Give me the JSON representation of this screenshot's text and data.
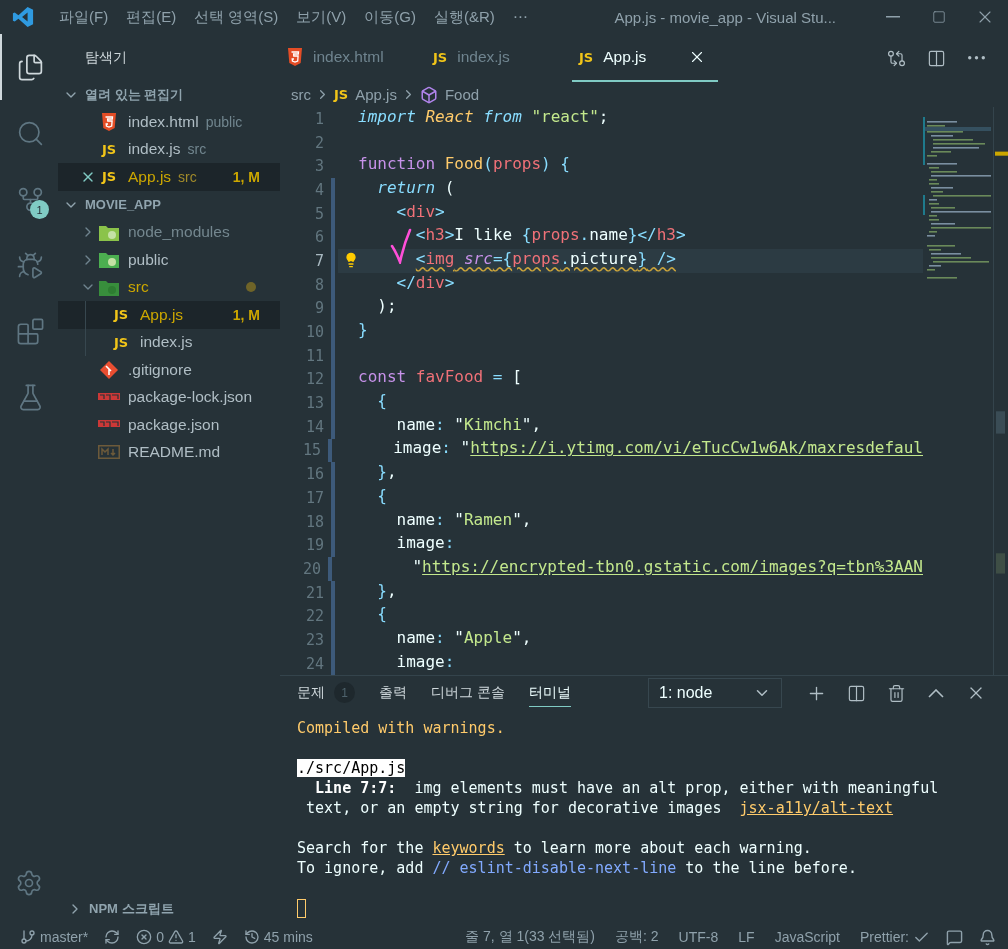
{
  "title_bar": {
    "menus": [
      "파일(F)",
      "편집(E)",
      "선택 영역(S)",
      "보기(V)",
      "이동(G)",
      "실행(&R)"
    ],
    "more": "⋯",
    "title": "App.js - movie_app - Visual Stu..."
  },
  "activity_bar": {
    "items": [
      {
        "kind": "explorer",
        "selected": true
      },
      {
        "kind": "search",
        "selected": false
      },
      {
        "kind": "source-control",
        "selected": false,
        "badge": "1"
      },
      {
        "kind": "run-debug",
        "selected": false
      },
      {
        "kind": "extensions",
        "selected": false
      },
      {
        "kind": "testing",
        "selected": false
      }
    ]
  },
  "explorer": {
    "title": "탐색기",
    "open_editors": {
      "title": "열려 있는 편집기",
      "expanded": true,
      "items": [
        {
          "kind": "html",
          "name": "index.html",
          "folder": "public",
          "selected": false,
          "warning": false
        },
        {
          "kind": "js",
          "icon_label": "JS",
          "name": "index.js",
          "folder": "src",
          "selected": false,
          "warning": false
        },
        {
          "kind": "js",
          "icon_label": "JS",
          "name": "App.js",
          "folder": "src",
          "badge": "1, M",
          "selected": true,
          "warning": true
        }
      ]
    },
    "project": {
      "title": "MOVIE_APP",
      "expanded": true,
      "items": [
        {
          "kind": "folder-node",
          "name": "node_modules",
          "expanded": false,
          "ignored": true,
          "selected": false,
          "warning": false,
          "modified": false
        },
        {
          "kind": "folder-public",
          "name": "public",
          "expanded": false,
          "ignored": false,
          "selected": false,
          "warning": false,
          "modified": false
        },
        {
          "kind": "folder-src",
          "name": "src",
          "expanded": true,
          "ignored": false,
          "selected": false,
          "warning": true,
          "modified": true,
          "children": [
            {
              "kind": "js",
              "icon_label": "JS",
              "name": "App.js",
              "badge": "1, M",
              "ignored": false,
              "selected": true,
              "warning": true
            },
            {
              "kind": "js",
              "icon_label": "JS",
              "name": "index.js",
              "ignored": false,
              "selected": false,
              "warning": false
            }
          ]
        },
        {
          "kind": "git",
          "name": ".gitignore",
          "ignored": false,
          "selected": false,
          "warning": false
        },
        {
          "kind": "npm",
          "name": "package-lock.json",
          "ignored": false,
          "selected": false,
          "warning": false
        },
        {
          "kind": "npm",
          "name": "package.json",
          "ignored": false,
          "selected": false,
          "warning": false
        },
        {
          "kind": "markdown",
          "name": "README.md",
          "ignored": false,
          "selected": false,
          "warning": false
        }
      ]
    },
    "npm_scripts": {
      "title": "NPM 스크립트",
      "expanded": false
    }
  },
  "editor": {
    "tabs": [
      {
        "kind": "html",
        "label": "index.html",
        "selected": false
      },
      {
        "kind": "js",
        "icon_label": "JS",
        "label": "index.js",
        "selected": false
      },
      {
        "kind": "js",
        "icon_label": "JS",
        "label": "App.js",
        "selected": true
      }
    ],
    "breadcrumb": [
      {
        "text": "src"
      },
      {
        "kind": "js",
        "icon_label": "JS",
        "text": "App.js"
      },
      {
        "kind": "symbol",
        "text": "Food"
      }
    ],
    "code": [
      {
        "number": "1",
        "modified": false,
        "current": false,
        "warning": false,
        "tokens": [
          {
            "text": "import",
            "kind": "kw"
          },
          {
            "text": " React",
            "kind": "cls"
          },
          {
            "text": " from",
            "kind": "kw"
          },
          {
            "text": " \"react\"",
            "kind": "str"
          },
          {
            "text": ";",
            "kind": "plain"
          }
        ]
      },
      {
        "number": "2",
        "modified": false,
        "current": false
      },
      {
        "number": "3",
        "modified": false,
        "current": false,
        "warning": false,
        "tokens": [
          {
            "text": "function",
            "kind": "decl"
          },
          {
            "text": " Food",
            "kind": "fn"
          },
          {
            "text": "(",
            "kind": "punct"
          },
          {
            "text": "props",
            "kind": "var"
          },
          {
            "text": ")",
            "kind": "punct"
          },
          {
            "text": " {",
            "kind": "punct"
          }
        ]
      },
      {
        "number": "4",
        "modified": true,
        "current": false,
        "warning": false,
        "tokens": [
          {
            "text": "  return",
            "kind": "kw"
          },
          {
            "text": " (",
            "kind": "plain"
          }
        ]
      },
      {
        "number": "5",
        "modified": true,
        "current": false,
        "warning": false,
        "tokens": [
          {
            "text": "    <",
            "kind": "punct"
          },
          {
            "text": "div",
            "kind": "var"
          },
          {
            "text": ">",
            "kind": "punct"
          }
        ]
      },
      {
        "number": "6",
        "modified": true,
        "current": false,
        "warning": false,
        "tokens": [
          {
            "text": "      <",
            "kind": "punct"
          },
          {
            "text": "h3",
            "kind": "var"
          },
          {
            "text": ">",
            "kind": "punct"
          },
          {
            "text": "I like ",
            "kind": "plain"
          },
          {
            "text": "{",
            "kind": "punct"
          },
          {
            "text": "props",
            "kind": "var"
          },
          {
            "text": ".",
            "kind": "punct"
          },
          {
            "text": "name",
            "kind": "plain"
          },
          {
            "text": "}</",
            "kind": "punct"
          },
          {
            "text": "h3",
            "kind": "var"
          },
          {
            "text": ">",
            "kind": "punct"
          }
        ]
      },
      {
        "number": "7",
        "modified": true,
        "current": true,
        "warning": true,
        "tokens": [
          {
            "text": "      <",
            "kind": "punct"
          },
          {
            "text": "img",
            "kind": "var"
          },
          {
            "text": " src",
            "kind": "attr"
          },
          {
            "text": "={",
            "kind": "punct"
          },
          {
            "text": "props",
            "kind": "var"
          },
          {
            "text": ".",
            "kind": "punct"
          },
          {
            "text": "picture",
            "kind": "plain"
          },
          {
            "text": "}",
            "kind": "punct"
          },
          {
            "text": " />",
            "kind": "punct"
          }
        ]
      },
      {
        "number": "8",
        "modified": true,
        "current": false,
        "warning": false,
        "tokens": [
          {
            "text": "    </",
            "kind": "punct"
          },
          {
            "text": "div",
            "kind": "var"
          },
          {
            "text": ">",
            "kind": "punct"
          }
        ]
      },
      {
        "number": "9",
        "modified": true,
        "current": false,
        "warning": false,
        "tokens": [
          {
            "text": "  );",
            "kind": "plain"
          }
        ]
      },
      {
        "number": "10",
        "modified": true,
        "current": false,
        "warning": false,
        "tokens": [
          {
            "text": "}",
            "kind": "punct"
          }
        ]
      },
      {
        "number": "11",
        "modified": true,
        "current": false
      },
      {
        "number": "12",
        "modified": true,
        "current": false,
        "warning": false,
        "tokens": [
          {
            "text": "const",
            "kind": "decl"
          },
          {
            "text": " favFood",
            "kind": "var"
          },
          {
            "text": " =",
            "kind": "punct"
          },
          {
            "text": " [",
            "kind": "plain"
          }
        ]
      },
      {
        "number": "13",
        "modified": true,
        "current": false,
        "warning": false,
        "tokens": [
          {
            "text": "  {",
            "kind": "punct"
          }
        ]
      },
      {
        "number": "14",
        "modified": true,
        "current": false,
        "warning": false,
        "tokens": [
          {
            "text": "    name",
            "kind": "plain"
          },
          {
            "text": ":",
            "kind": "punct"
          },
          {
            "text": " \"",
            "kind": "plain"
          },
          {
            "text": "Kimchi",
            "kind": "str"
          },
          {
            "text": "\",",
            "kind": "plain"
          }
        ]
      },
      {
        "number": "15",
        "modified": true,
        "current": false,
        "warning": false,
        "tokens": [
          {
            "text": "    image",
            "kind": "plain"
          },
          {
            "text": ":",
            "kind": "punct"
          },
          {
            "text": " \"",
            "kind": "plain"
          },
          {
            "text": "https://i.ytimg.com/vi/eTucCw1w6Ak/maxresdefaul",
            "kind": "url"
          }
        ]
      },
      {
        "number": "16",
        "modified": true,
        "current": false,
        "warning": false,
        "tokens": [
          {
            "text": "  }",
            "kind": "punct"
          },
          {
            "text": ",",
            "kind": "plain"
          }
        ]
      },
      {
        "number": "17",
        "modified": true,
        "current": false,
        "warning": false,
        "tokens": [
          {
            "text": "  {",
            "kind": "punct"
          }
        ]
      },
      {
        "number": "18",
        "modified": true,
        "current": false,
        "warning": false,
        "tokens": [
          {
            "text": "    name",
            "kind": "plain"
          },
          {
            "text": ":",
            "kind": "punct"
          },
          {
            "text": " \"",
            "kind": "plain"
          },
          {
            "text": "Ramen",
            "kind": "str"
          },
          {
            "text": "\",",
            "kind": "plain"
          }
        ]
      },
      {
        "number": "19",
        "modified": true,
        "current": false,
        "warning": false,
        "tokens": [
          {
            "text": "    image",
            "kind": "plain"
          },
          {
            "text": ":",
            "kind": "punct"
          }
        ]
      },
      {
        "number": "20",
        "modified": true,
        "current": false,
        "warning": false,
        "tokens": [
          {
            "text": "      \"",
            "kind": "plain"
          },
          {
            "text": "https://encrypted-tbn0.gstatic.com/images?q=tbn%3AAN",
            "kind": "url"
          }
        ]
      },
      {
        "number": "21",
        "modified": true,
        "current": false,
        "warning": false,
        "tokens": [
          {
            "text": "  }",
            "kind": "punct"
          },
          {
            "text": ",",
            "kind": "plain"
          }
        ]
      },
      {
        "number": "22",
        "modified": true,
        "current": false,
        "warning": false,
        "tokens": [
          {
            "text": "  {",
            "kind": "punct"
          }
        ]
      },
      {
        "number": "23",
        "modified": true,
        "current": false,
        "warning": false,
        "tokens": [
          {
            "text": "    name",
            "kind": "plain"
          },
          {
            "text": ":",
            "kind": "punct"
          },
          {
            "text": " \"",
            "kind": "plain"
          },
          {
            "text": "Apple",
            "kind": "str"
          },
          {
            "text": "\",",
            "kind": "plain"
          }
        ]
      },
      {
        "number": "24",
        "modified": true,
        "current": false,
        "warning": false,
        "tokens": [
          {
            "text": "    image",
            "kind": "plain"
          },
          {
            "text": ":",
            "kind": "punct"
          }
        ]
      }
    ]
  },
  "panel": {
    "tabs": [
      {
        "label": "문제",
        "badge": "1",
        "selected": false
      },
      {
        "label": "출력",
        "selected": false
      },
      {
        "label": "디버그 콘솔",
        "selected": false
      },
      {
        "label": "터미널",
        "selected": true
      }
    ],
    "terminal_select": "1: node",
    "terminal": {
      "cursor": true,
      "lines": [
        {
          "kind": "text",
          "spans": [
            {
              "text": "Compiled with warnings.",
              "kind": "warn"
            }
          ]
        },
        {
          "kind": "blank"
        },
        {
          "kind": "text",
          "spans": [
            {
              "text": "./src/App.js",
              "kind": "highlight"
            }
          ]
        },
        {
          "kind": "text",
          "spans": [
            {
              "text": "  Line 7:7:",
              "kind": "bold"
            },
            {
              "text": "  img elements must have an alt prop, either with meaningful",
              "kind": "plain"
            }
          ]
        },
        {
          "kind": "text",
          "spans": [
            {
              "text": " text, or an empty string for decorative images  ",
              "kind": "plain"
            },
            {
              "text": "jsx-a11y/alt-text",
              "kind": "link"
            }
          ]
        },
        {
          "kind": "blank"
        },
        {
          "kind": "text",
          "spans": [
            {
              "text": "Search for the ",
              "kind": "plain"
            },
            {
              "text": "keywords",
              "kind": "link"
            },
            {
              "text": " to learn more about each warning.",
              "kind": "plain"
            }
          ]
        },
        {
          "kind": "text",
          "spans": [
            {
              "text": "To ignore, add ",
              "kind": "plain"
            },
            {
              "text": "// eslint-disable-next-line",
              "kind": "comment"
            },
            {
              "text": " to the line before.",
              "kind": "plain"
            }
          ]
        },
        {
          "kind": "blank"
        }
      ]
    }
  },
  "status_bar": {
    "branch": "master*",
    "errors": "0",
    "warnings": "1",
    "history": "45 mins",
    "right": [
      "줄 7, 열 1(33 선택됨)",
      "공백: 2",
      "UTF-8",
      "LF",
      "JavaScript"
    ],
    "formatter": "Prettier:"
  }
}
